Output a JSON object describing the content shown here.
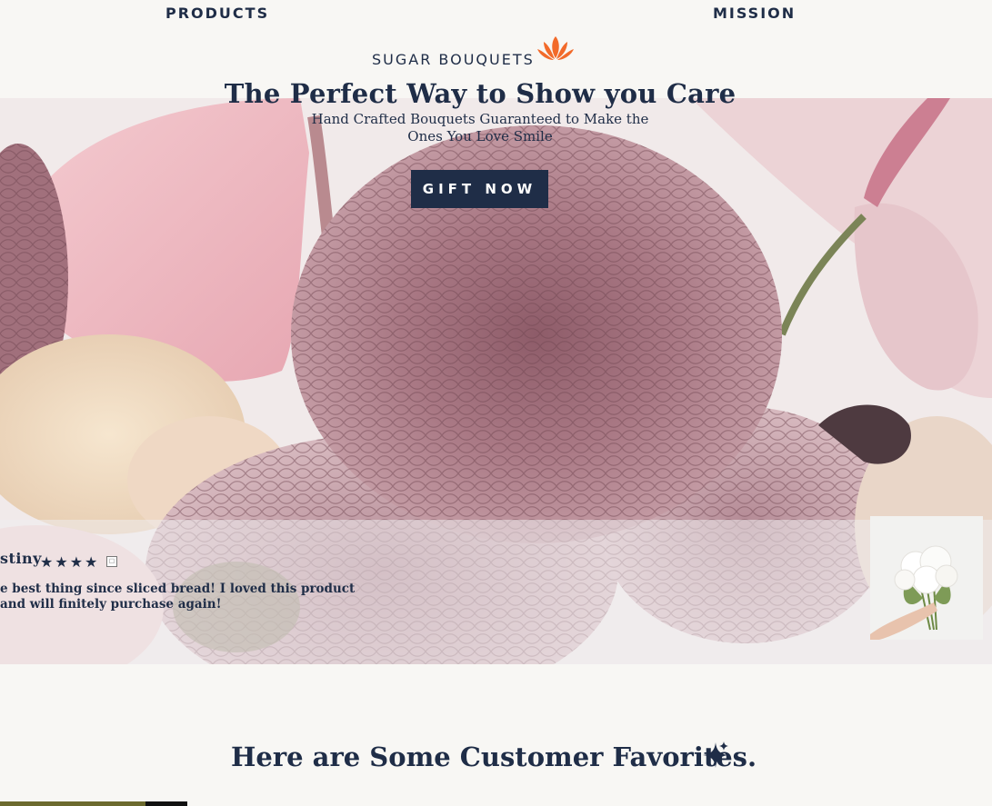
{
  "nav": {
    "products": "PRODUCTS",
    "mission": "MISSION"
  },
  "brand": {
    "name": "SUGAR BOUQUETS",
    "logo_icon": "lotus-icon",
    "logo_color": "#f26a2a"
  },
  "hero": {
    "title": "The Perfect Way to Show you Care",
    "subtitle": "Hand Crafted Bouquets Guaranteed to Make the Ones You Love Smile",
    "cta": "GIFT NOW"
  },
  "review": {
    "name": "stiny",
    "stars": "★★★★",
    "rating": 4,
    "empty_star": "☐",
    "text": "e best thing since sliced bread! I loved this product and will finitely purchase again!",
    "image_icon": "bouquet-in-hand-image"
  },
  "favorites": {
    "title": "Here are Some Customer Favorites.",
    "icon": "sparkle-icon"
  },
  "colors": {
    "navy": "#1f2d47",
    "accent": "#f26a2a",
    "background": "#f8f7f4"
  }
}
